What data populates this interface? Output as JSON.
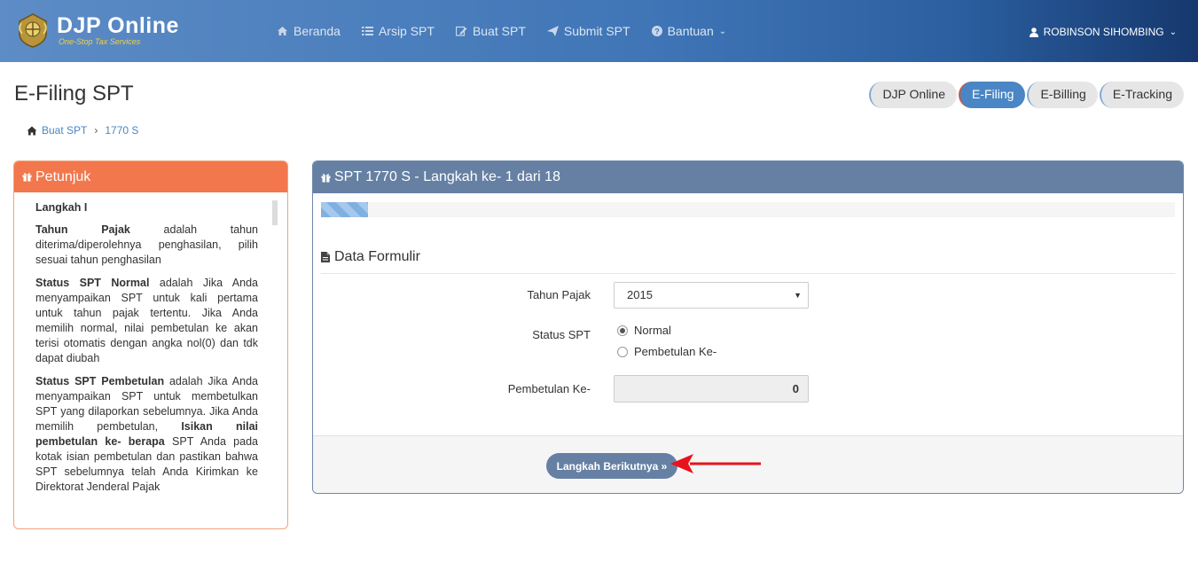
{
  "brand": {
    "title": "DJP Online",
    "subtitle": "One-Stop Tax Services"
  },
  "nav": {
    "items": [
      {
        "label": "Beranda",
        "icon": "home-icon"
      },
      {
        "label": "Arsip SPT",
        "icon": "list-icon"
      },
      {
        "label": "Buat SPT",
        "icon": "edit-icon"
      },
      {
        "label": "Submit SPT",
        "icon": "send-icon"
      },
      {
        "label": "Bantuan",
        "icon": "help-icon"
      }
    ],
    "user": "ROBINSON SIHOMBING"
  },
  "page": {
    "title": "E-Filing SPT",
    "pills": [
      "DJP Online",
      "E-Filing",
      "E-Billing",
      "E-Tracking"
    ],
    "active_pill": "E-Filing"
  },
  "breadcrumb": {
    "items": [
      "Buat SPT",
      "1770 S"
    ]
  },
  "petunjuk": {
    "title": "Petunjuk",
    "heading": "Langkah I",
    "p1_bold": "Tahun Pajak",
    "p1_text": " adalah tahun diterima/diperolehnya penghasilan, pilih sesuai tahun penghasilan",
    "p2_bold": "Status SPT Normal",
    "p2_text": " adalah Jika Anda menyampaikan SPT untuk kali pertama untuk tahun pajak tertentu. Jika Anda memilih normal, nilai pembetulan ke akan terisi otomatis dengan angka nol(0) dan tdk dapat diubah",
    "p3_bold": "Status SPT Pembetulan",
    "p3_text1": " adalah Jika Anda menyampaikan SPT untuk membetulkan SPT yang dilaporkan sebelumnya. Jika Anda memilih pembetulan, ",
    "p3_bold2": "Isikan nilai pembetulan ke- berapa",
    "p3_text2": " SPT Anda pada kotak isian pembetulan dan pastikan bahwa SPT sebelumnya telah Anda Kirimkan ke Direktorat Jenderal Pajak"
  },
  "form": {
    "panel_title": "SPT 1770 S - Langkah ke- 1 dari 18",
    "progress_fraction": 0.055,
    "section_title": "Data Formulir",
    "tahun_label": "Tahun Pajak",
    "tahun_value": "2015",
    "status_label": "Status SPT",
    "status_options": [
      "Normal",
      "Pembetulan Ke-"
    ],
    "status_selected": "Normal",
    "pembetulan_label": "Pembetulan Ke-",
    "pembetulan_value": "0",
    "next_button": "Langkah Berikutnya »"
  },
  "colors": {
    "navbar": "#3f75b6",
    "petunjuk_header": "#f3774c",
    "panel_header": "#6680a4",
    "active_pill": "#4a86c5",
    "arrow": "#e8121c"
  }
}
